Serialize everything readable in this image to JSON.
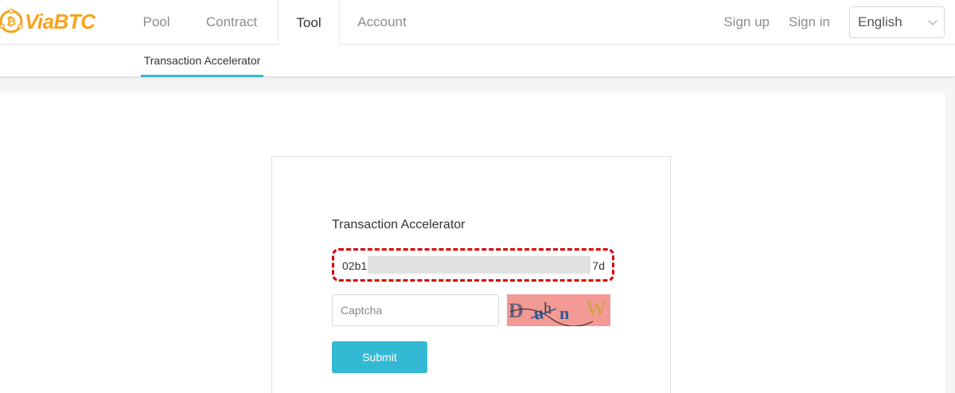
{
  "brand": {
    "name": "ViaBTC",
    "color": "#f7a21b"
  },
  "nav": {
    "items": [
      {
        "label": "Pool",
        "active": false
      },
      {
        "label": "Contract",
        "active": false
      },
      {
        "label": "Tool",
        "active": true
      },
      {
        "label": "Account",
        "active": false
      }
    ],
    "sign_up": "Sign up",
    "sign_in": "Sign in",
    "language": {
      "selected": "English",
      "icon": "chevron-down-icon"
    }
  },
  "subnav": {
    "active_tab": "Transaction Accelerator",
    "accent": "#2fb8d4"
  },
  "form": {
    "title": "Transaction Accelerator",
    "txid_prefix": "02b1",
    "txid_suffix": "7d",
    "captcha_placeholder": "Captcha",
    "captcha_text": "DuhnW",
    "submit_label": "Submit",
    "submit_color": "#33b9d4",
    "highlight_color": "#d40000"
  }
}
